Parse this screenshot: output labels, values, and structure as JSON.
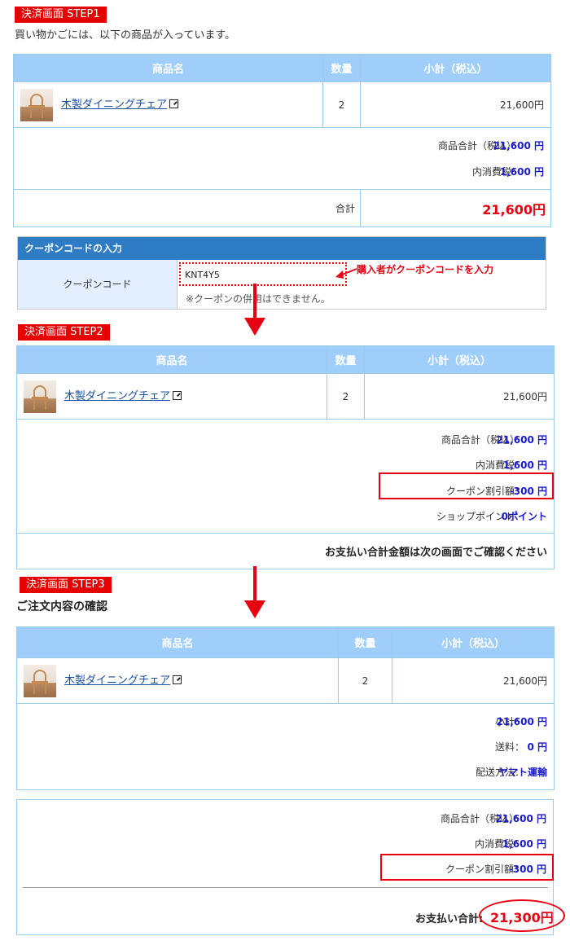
{
  "step1": {
    "badge": "決済画面 STEP1",
    "intro": "買い物かごには、以下の商品が入っています。",
    "headers": {
      "product": "商品名",
      "qty": "数量",
      "subtotal": "小計（税込）"
    },
    "item": {
      "name": "木製ダイニングチェア",
      "qty": "2",
      "subtotal": "21,600円"
    },
    "summary": [
      {
        "label": "商品合計（税込）：",
        "value": "21,600 円"
      },
      {
        "label": "内消費税：",
        "value": "1,600 円"
      }
    ],
    "total_label": "合計",
    "total_value": "21,600円"
  },
  "coupon": {
    "header": "クーポンコードの入力",
    "label": "クーポンコード",
    "value": "KNT4Y5",
    "note": "※クーポンの併用はできません。",
    "annotation": "購入者がクーポンコードを入力"
  },
  "step2": {
    "badge": "決済画面 STEP2",
    "headers": {
      "product": "商品名",
      "qty": "数量",
      "subtotal": "小計（税込）"
    },
    "item": {
      "name": "木製ダイニングチェア",
      "qty": "2",
      "subtotal": "21,600円"
    },
    "summary": [
      {
        "label": "商品合計（税込）：",
        "value": "21,600 円"
      },
      {
        "label": "内消費税：",
        "value": "1,600 円"
      },
      {
        "label": "クーポン割引額：",
        "value": "-300 円"
      },
      {
        "label": "ショップポイント：",
        "value": "0ポイント"
      }
    ],
    "confirm_message": "お支払い合計金額は次の画面でご確認ください"
  },
  "step3": {
    "badge": "決済画面 STEP3",
    "heading": "ご注文内容の確認",
    "headers": {
      "product": "商品名",
      "qty": "数量",
      "subtotal": "小計（税込）"
    },
    "item": {
      "name": "木製ダイニングチェア",
      "qty": "2",
      "subtotal": "21,600円"
    },
    "shipping": [
      {
        "label": "小計：",
        "value": "21,600 円"
      },
      {
        "label": "送料：",
        "value": "0 円"
      },
      {
        "label": "配送方法：",
        "value": "ヤマト運輸"
      }
    ],
    "summary": [
      {
        "label": "商品合計（税込）：",
        "value": "21,600 円"
      },
      {
        "label": "内消費税：",
        "value": "1,600 円"
      },
      {
        "label": "クーポン割引額：",
        "value": "-300 円"
      }
    ],
    "payment_label": "お支払い合計:",
    "payment_value": "21,300円"
  },
  "colors": {
    "accent_red": "#e60012",
    "header_blue": "#9fcefa",
    "coupon_header": "#2e7dc4",
    "value_blue": "#1a1acc"
  }
}
